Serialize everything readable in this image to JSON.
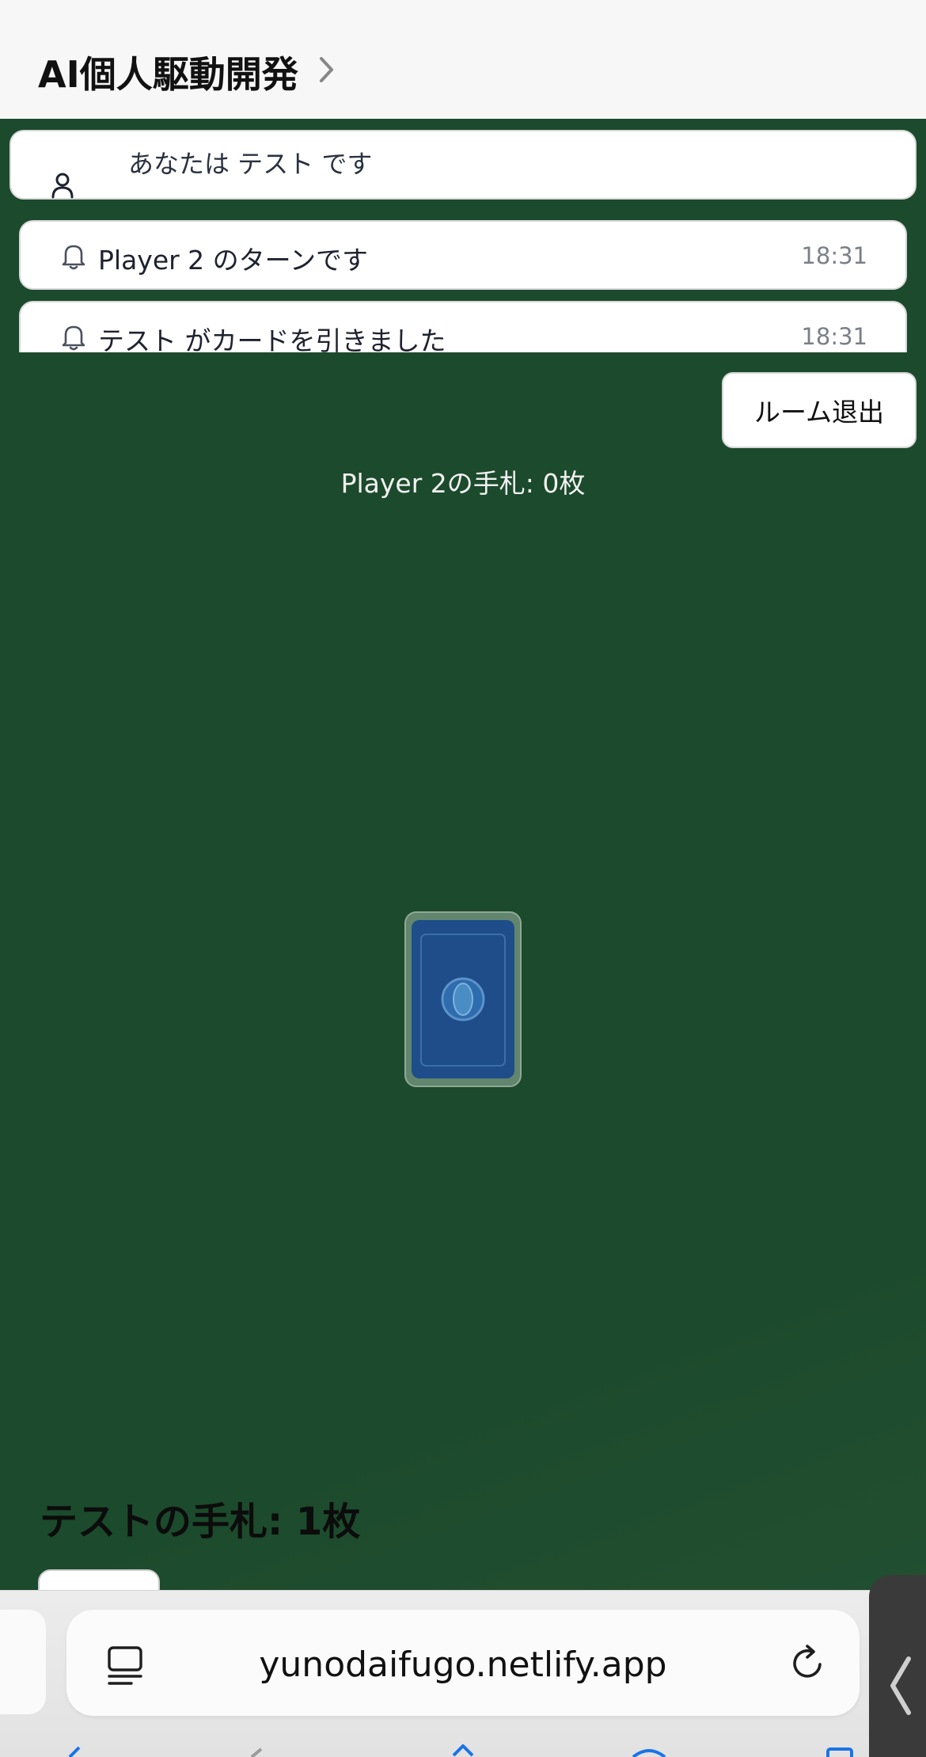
{
  "header": {
    "title": "AI個人駆動開発",
    "chevron_icon": "chevron-right-icon"
  },
  "notifications": {
    "player_identity": "あなたは テスト です",
    "items": [
      {
        "text": "Player 2 のターンです",
        "time": "18:31",
        "icon": "bell-icon"
      },
      {
        "text": "テスト がカードを引きました",
        "time": "18:31",
        "icon": "bell-icon"
      }
    ]
  },
  "game": {
    "leave_button": "ルーム退出",
    "opponent_hand": "Player 2の手札: 0枚",
    "my_hand": "テストの手札: 1枚",
    "table_color": "#1c4a2c",
    "deck_color": "#1e4d8a"
  },
  "browser": {
    "url": "yunodaifugo.netlify.app",
    "reader_icon": "reader-mode-icon",
    "reload_icon": "reload-icon",
    "tab_icon": "chevron-left-icon"
  }
}
